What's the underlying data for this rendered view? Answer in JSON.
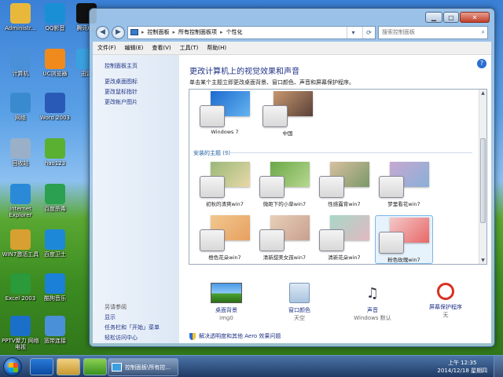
{
  "desktop": {
    "icons": [
      {
        "label": "Administr...",
        "icon": "user-folder-icon",
        "color": "#e8b83c"
      },
      {
        "label": "QQ影音",
        "icon": "qq-player-icon",
        "color": "#1a8fd6"
      },
      {
        "label": "腾讯QQ",
        "icon": "qq-penguin-icon",
        "color": "#111111"
      },
      {
        "label": "计算机",
        "icon": "computer-icon",
        "color": "#4a90d8"
      },
      {
        "label": "UC浏览器",
        "icon": "uc-browser-icon",
        "color": "#f08a1c"
      },
      {
        "label": "迅雷",
        "icon": "thunder-icon",
        "color": "#3aa0e0"
      },
      {
        "label": "网络",
        "icon": "network-icon",
        "color": "#3a8ad0"
      },
      {
        "label": "Word 2003",
        "icon": "word-icon",
        "color": "#2a5ab8"
      },
      {
        "label": "回收站",
        "icon": "recycle-bin-icon",
        "color": "#9ab0c8"
      },
      {
        "label": "hao123",
        "icon": "hao123-icon",
        "color": "#5ab030"
      },
      {
        "label": "Internet Explorer",
        "icon": "ie-icon",
        "color": "#2a8ad8"
      },
      {
        "label": "百度杀毒",
        "icon": "baidu-antivirus-icon",
        "color": "#2aa050"
      },
      {
        "label": "WIN7激活工具",
        "icon": "win7-activate-icon",
        "color": "#d8a030"
      },
      {
        "label": "百度卫士",
        "icon": "baidu-guard-icon",
        "color": "#1e88d8"
      },
      {
        "label": "Excel 2003",
        "icon": "excel-icon",
        "color": "#2a9a3a"
      },
      {
        "label": "酷狗音乐",
        "icon": "kugou-icon",
        "color": "#1a80d8"
      },
      {
        "label": "PPTV聚力 网络电视",
        "icon": "pptv-icon",
        "color": "#1a70c8"
      },
      {
        "label": "宽带连接",
        "icon": "broadband-icon",
        "color": "#4a90d8"
      }
    ]
  },
  "window": {
    "address": {
      "crumbs": [
        "控制面板",
        "所有控制面板项",
        "个性化"
      ],
      "search_placeholder": "搜索控制面板"
    },
    "menu": [
      "文件(F)",
      "编辑(E)",
      "查看(V)",
      "工具(T)",
      "帮助(H)"
    ],
    "sidebar": {
      "home": "控制面板主页",
      "links": [
        "更改桌面图标",
        "更改鼠标指针",
        "更改帐户图片"
      ],
      "see_also_header": "另请参阅",
      "see_also": [
        "显示",
        "任务栏和「开始」菜单",
        "轻松访问中心"
      ]
    },
    "main": {
      "title": "更改计算机上的视觉效果和声音",
      "subtitle": "单击某个主题立即更改桌面背景、窗口颜色、声音和屏幕保护程序。",
      "top_themes": [
        {
          "label": "Windows 7",
          "colors": [
            "#1e6ad0",
            "#64b4f0"
          ]
        },
        {
          "label": "中国",
          "colors": [
            "#c89870",
            "#5a4038"
          ]
        }
      ],
      "installed_header": "安装的主题 (9)",
      "installed_themes": [
        {
          "label": "初秋的清爽win7",
          "colors": [
            "#9ab878",
            "#e8d8a8"
          ],
          "selected": false
        },
        {
          "label": "微距下的小草win7",
          "colors": [
            "#6aa848",
            "#b8d890"
          ],
          "selected": false
        },
        {
          "label": "性感露背win7",
          "colors": [
            "#d8c0a0",
            "#7a9868"
          ],
          "selected": false
        },
        {
          "label": "梦里看花win7",
          "colors": [
            "#c8a8d0",
            "#88b0d8"
          ],
          "selected": false
        },
        {
          "label": "橙色花朵win7",
          "colors": [
            "#f0c890",
            "#e8a060"
          ],
          "selected": false
        },
        {
          "label": "清新甜美女孩win7",
          "colors": [
            "#e8d0b8",
            "#c8a090"
          ],
          "selected": false
        },
        {
          "label": "清新花朵win7",
          "colors": [
            "#a8d8c8",
            "#e0b8c0"
          ],
          "selected": false
        },
        {
          "label": "粉色玫瑰win7",
          "colors": [
            "#f4c8c8",
            "#e86868"
          ],
          "selected": true
        }
      ],
      "settings": [
        {
          "label": "桌面背景",
          "value": "img0",
          "icon": "desktop-background-icon"
        },
        {
          "label": "窗口颜色",
          "value": "天空",
          "icon": "window-color-icon"
        },
        {
          "label": "声音",
          "value": "Windows 默认",
          "icon": "sound-icon"
        },
        {
          "label": "屏幕保护程序",
          "value": "无",
          "icon": "screensaver-icon"
        }
      ],
      "aero_link": "解决透明度和其他 Aero 效果问题"
    }
  },
  "taskbar": {
    "task_label": "控制面板\\所有控...",
    "time": "上午 12:35",
    "date": "2014/12/18 星期四"
  }
}
